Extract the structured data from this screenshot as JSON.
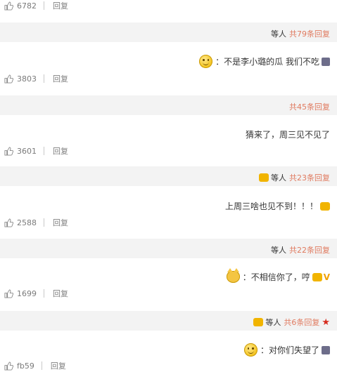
{
  "rows": [
    {
      "likes": "6782",
      "reply": "回复",
      "count_text": "共79条回复",
      "people": "等人",
      "comment": "：不是李小璐的瓜 我们不吃"
    },
    {
      "likes": "3803",
      "reply": "回复",
      "count_text": "共45条回复",
      "comment": "猜来了，周三见不见了"
    },
    {
      "likes": "3601",
      "reply": "回复",
      "count_text": "共23条回复",
      "people": "等人",
      "comment": "上周三啥也见不到！！！"
    },
    {
      "likes": "2588",
      "reply": "回复",
      "count_text": "共22条回复",
      "people": "等人",
      "comment": "：不相信你了，哼"
    },
    {
      "likes": "1699",
      "reply": "回复",
      "count_text": "共6条回复",
      "people": "等人",
      "comment": "：对你们失望了"
    },
    {
      "likes": "fb59",
      "reply": "回复"
    }
  ],
  "icons": {
    "like": "thumbs-up-icon",
    "smile": "smile-emoji-icon",
    "cat": "cat-emoji-icon",
    "crown": "crown-icon",
    "star": "star-icon",
    "avatar": "avatar-icon"
  },
  "colors": {
    "reply_count": "#e07a5f",
    "band": "#f3f3f3",
    "vip": "#f1a000",
    "star": "#d62d20"
  }
}
